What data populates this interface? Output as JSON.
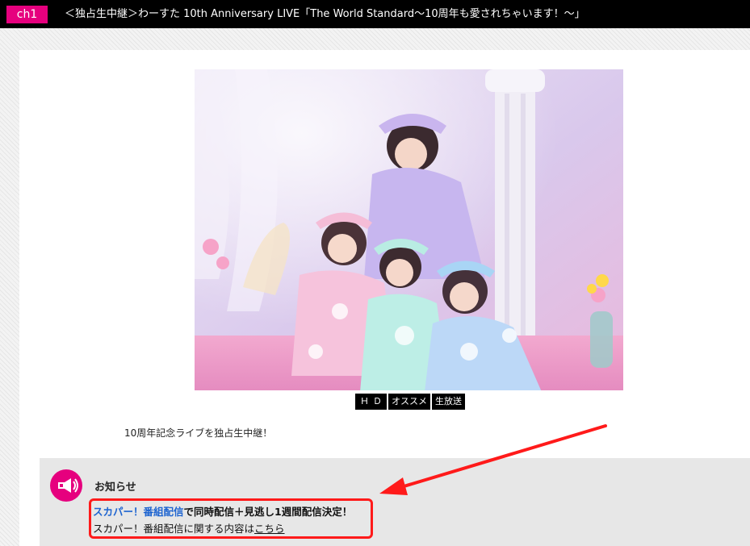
{
  "header": {
    "channel": "ch1",
    "program_title": "＜独占生中継＞わーすた 10th Anniversary LIVE「The World Standard～10周年も愛されちゃいます！～」"
  },
  "tags": [
    "ＨＤ",
    "オススメ",
    "生放送"
  ],
  "lead_text": "10周年記念ライブを独占生中継！",
  "notice": {
    "icon": "megaphone-icon",
    "heading": "お知らせ",
    "line1_link": "スカパー！番組配信",
    "line1_rest": "で同時配信＋見逃し1週間配信決定！",
    "line2_text": "スカパー！番組配信に関する内容は",
    "line2_link": "こちら"
  },
  "colors": {
    "accent": "#e6007e",
    "annotation": "#ff1a1a",
    "link": "#1e64d0"
  }
}
